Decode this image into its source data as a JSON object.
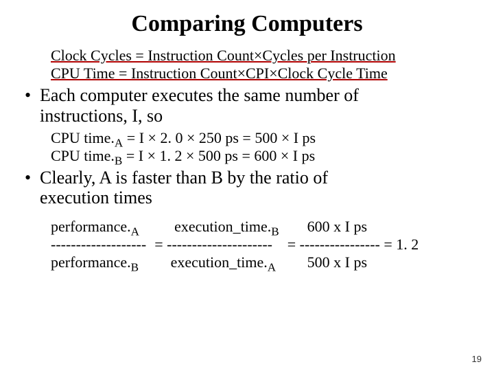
{
  "title": "Comparing Computers",
  "formulas": {
    "line1": "Clock Cycles = Instruction Count×Cycles per Instruction",
    "line2": "CPU Time = Instruction Count×CPI×Clock Cycle Time"
  },
  "bullet1": {
    "marker": "•",
    "line1": "Each computer executes the same number of",
    "line2": "instructions, I, so"
  },
  "cpu_times": {
    "a_prefix": "CPU time.",
    "a_sub": "A",
    "a_rest": " = I × 2. 0 × 250 ps = 500 × I ps",
    "b_prefix": "CPU time.",
    "b_sub": "B",
    "b_rest": " = I × 1. 2 × 500 ps = 600 × I ps"
  },
  "bullet2": {
    "marker": "•",
    "line1": "Clearly, A is faster than B by the ratio of",
    "line2": "execution times"
  },
  "ratio": {
    "perf_label": "performance.",
    "exec_label": "execution_time.",
    "sub_a": "A",
    "sub_b": "B",
    "dash1": "-------------------",
    "dash2": "---------------------",
    "dash3": "----------------",
    "val_top": "600 x I ps",
    "val_bot": "500 x I ps",
    "eq": " = ",
    "result": " = 1. 2"
  },
  "page_number": "19"
}
